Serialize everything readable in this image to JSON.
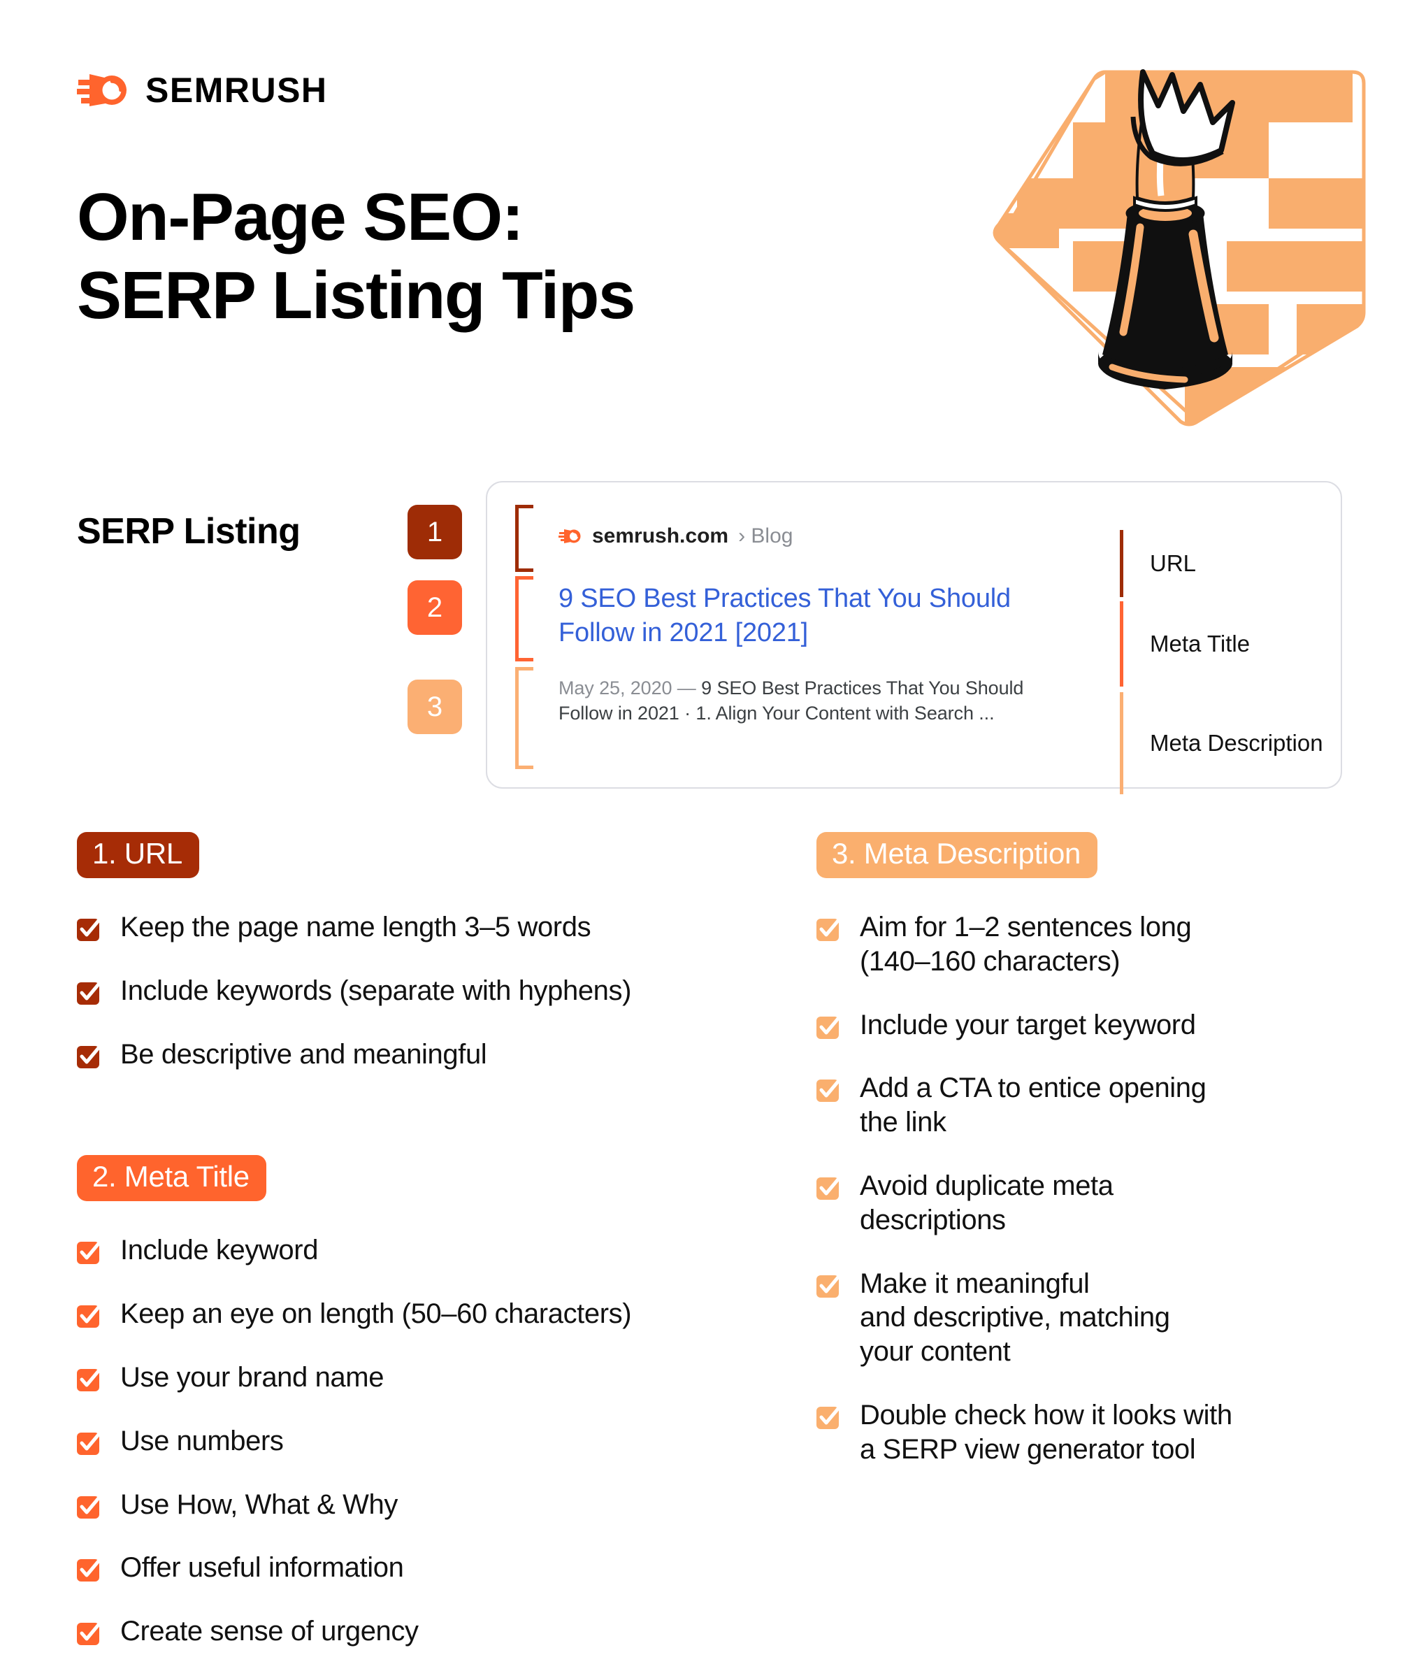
{
  "brand": {
    "logo_text": "SEMRUSH",
    "logo_icon": "semrush-comet-icon",
    "accent_orange": "#FF642D"
  },
  "header": {
    "title": "On-Page SEO:\nSERP Listing Tips"
  },
  "hero": {
    "illustration_name": "chessboard-king-illustration",
    "board_color": "#F9AE6E",
    "piece_color": "#101010"
  },
  "serp_section": {
    "heading": "SERP Listing",
    "markers": [
      {
        "number": "1",
        "color": "#9E2C06"
      },
      {
        "number": "2",
        "color": "#FF6433"
      },
      {
        "number": "3",
        "color": "#FBAF73"
      }
    ],
    "listing": {
      "favicon": "semrush-favicon-icon",
      "domain": "semrush.com",
      "breadcrumb": "› Blog",
      "title": "9 SEO Best Practices That You Should Follow in 2021 [2021]",
      "title_color": "#3460D8",
      "description_date": "May 25, 2020 — ",
      "description": "9 SEO Best Practices That You Should Follow in 2021 · 1. Align Your Content with Search  ..."
    },
    "legend": [
      {
        "label": "URL",
        "color": "#9E2C06"
      },
      {
        "label": "Meta Title",
        "color": "#FF6433"
      },
      {
        "label": "Meta Description",
        "color": "#FBAF73"
      }
    ]
  },
  "sections": [
    {
      "badge": "1. URL",
      "color": "#A62C06",
      "items": [
        "Keep the page name length 3–5 words",
        "Include keywords (separate with hyphens)",
        "Be descriptive and meaningful"
      ]
    },
    {
      "badge": "2. Meta Title",
      "color": "#FF642D",
      "items": [
        "Include keyword",
        "Keep an eye on length (50–60 characters)",
        "Use your brand name",
        "Use numbers",
        "Use How, What & Why",
        "Offer useful information",
        "Create sense of urgency"
      ]
    },
    {
      "badge": "3. Meta Description",
      "color": "#FAAF6E",
      "items": [
        "Aim for 1–2 sentences long\n(140–160 characters)",
        "Include your target keyword",
        "Add a CTA to entice opening\nthe link",
        "Avoid duplicate meta\ndescriptions",
        "Make it meaningful\nand descriptive, matching\nyour content",
        "Double check how it looks with\na SERP view generator tool"
      ]
    }
  ]
}
